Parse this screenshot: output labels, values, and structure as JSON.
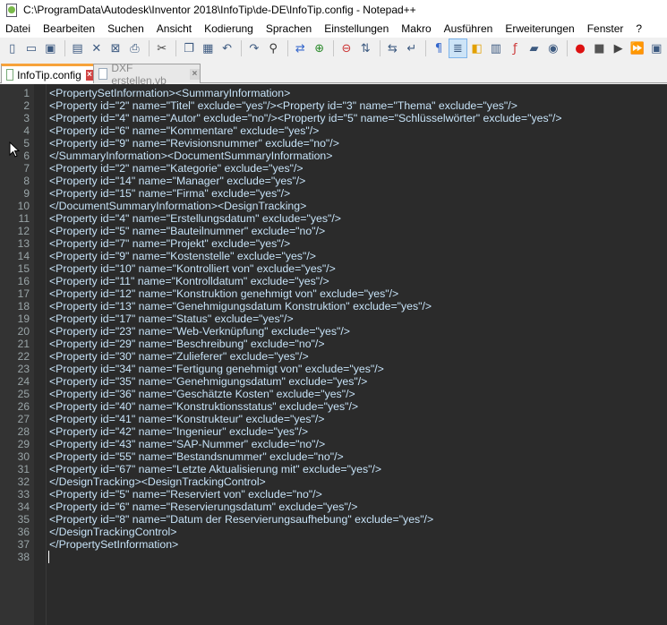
{
  "window": {
    "title": "C:\\ProgramData\\Autodesk\\Inventor 2018\\InfoTip\\de-DE\\InfoTip.config - Notepad++"
  },
  "menu": [
    "Datei",
    "Bearbeiten",
    "Suchen",
    "Ansicht",
    "Kodierung",
    "Sprachen",
    "Einstellungen",
    "Makro",
    "Ausführen",
    "Erweiterungen",
    "Fenster",
    "?"
  ],
  "toolbar": {
    "buttons": [
      "new-file-icon",
      "open-file-icon",
      "save-icon",
      "save-all-icon",
      "close-icon",
      "close-all-icon",
      "print-icon",
      "cut-icon",
      "copy-icon",
      "paste-icon",
      "undo-icon",
      "redo-icon",
      "find-icon",
      "replace-icon",
      "zoom-in-icon",
      "zoom-out-icon",
      "sync-vertical-icon",
      "sync-horizontal-icon",
      "word-wrap-icon",
      "show-all-chars-icon",
      "indent-guide-icon",
      "user-language-icon",
      "document-map-icon",
      "function-list-icon",
      "folder-workspace-icon",
      "monitoring-icon",
      "record-macro-icon",
      "stop-record-icon",
      "play-macro-icon",
      "run-macro-multiple-icon",
      "save-macro-icon"
    ]
  },
  "tabs": [
    {
      "label": "InfoTip.config",
      "active": true
    },
    {
      "label": "DXF erstellen.vb",
      "active": false
    }
  ],
  "editor": {
    "lines": [
      "<PropertySetInformation><SummaryInformation>",
      "<Property id=\"2\" name=\"Titel\" exclude=\"yes\"/><Property id=\"3\" name=\"Thema\" exclude=\"yes\"/>",
      "<Property id=\"4\" name=\"Autor\" exclude=\"no\"/><Property id=\"5\" name=\"Schlüsselwörter\" exclude=\"yes\"/>",
      "<Property id=\"6\" name=\"Kommentare\" exclude=\"yes\"/>",
      "<Property id=\"9\" name=\"Revisionsnummer\" exclude=\"no\"/>",
      "</SummaryInformation><DocumentSummaryInformation>",
      "<Property id=\"2\" name=\"Kategorie\" exclude=\"yes\"/>",
      "<Property id=\"14\" name=\"Manager\" exclude=\"yes\"/>",
      "<Property id=\"15\" name=\"Firma\" exclude=\"yes\"/>",
      "</DocumentSummaryInformation><DesignTracking>",
      "<Property id=\"4\" name=\"Erstellungsdatum\" exclude=\"yes\"/>",
      "<Property id=\"5\" name=\"Bauteilnummer\" exclude=\"no\"/>",
      "<Property id=\"7\" name=\"Projekt\" exclude=\"yes\"/>",
      "<Property id=\"9\" name=\"Kostenstelle\" exclude=\"yes\"/>",
      "<Property id=\"10\" name=\"Kontrolliert von\" exclude=\"yes\"/>",
      "<Property id=\"11\" name=\"Kontrolldatum\" exclude=\"yes\"/>",
      "<Property id=\"12\" name=\"Konstruktion genehmigt von\" exclude=\"yes\"/>",
      "<Property id=\"13\" name=\"Genehmigungsdatum Konstruktion\" exclude=\"yes\"/>",
      "<Property id=\"17\" name=\"Status\" exclude=\"yes\"/>",
      "<Property id=\"23\" name=\"Web-Verknüpfung\" exclude=\"yes\"/>",
      "<Property id=\"29\" name=\"Beschreibung\" exclude=\"no\"/>",
      "<Property id=\"30\" name=\"Zulieferer\" exclude=\"yes\"/>",
      "<Property id=\"34\" name=\"Fertigung genehmigt von\" exclude=\"yes\"/>",
      "<Property id=\"35\" name=\"Genehmigungsdatum\" exclude=\"yes\"/>",
      "<Property id=\"36\" name=\"Geschätzte Kosten\" exclude=\"yes\"/>",
      "<Property id=\"40\" name=\"Konstruktionsstatus\" exclude=\"yes\"/>",
      "<Property id=\"41\" name=\"Konstrukteur\" exclude=\"yes\"/>",
      "<Property id=\"42\" name=\"Ingenieur\" exclude=\"yes\"/>",
      "<Property id=\"43\" name=\"SAP-Nummer\" exclude=\"no\"/>",
      "<Property id=\"55\" name=\"Bestandsnummer\" exclude=\"no\"/>",
      "<Property id=\"67\" name=\"Letzte Aktualisierung mit\" exclude=\"yes\"/>",
      "</DesignTracking><DesignTrackingControl>",
      "<Property id=\"5\" name=\"Reserviert von\" exclude=\"no\"/>",
      "<Property id=\"6\" name=\"Reservierungsdatum\" exclude=\"yes\"/>",
      "<Property id=\"8\" name=\"Datum der Reservierungsaufhebung\" exclude=\"yes\"/>",
      "</DesignTrackingControl>",
      "</PropertySetInformation>",
      ""
    ]
  }
}
